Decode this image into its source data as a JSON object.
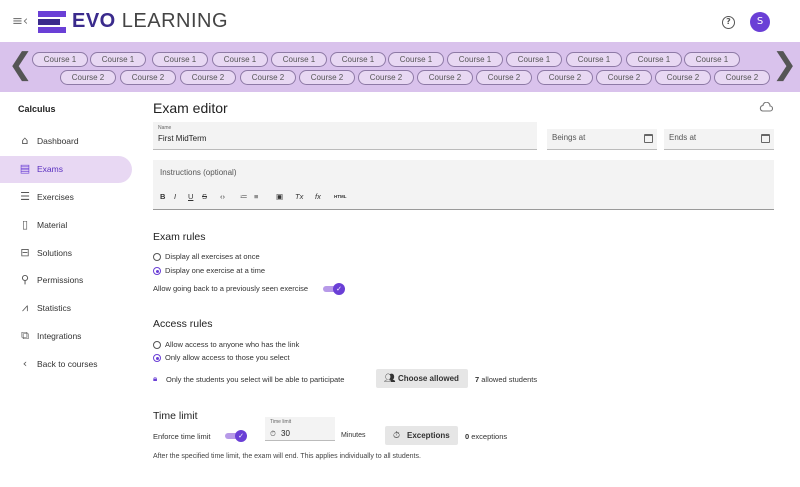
{
  "app": {
    "brand_bold": "EVO",
    "brand_rest": " LEARNING",
    "avatar_initial": "S",
    "help_symbol": "?",
    "menu_icon": "menu-collapse-icon",
    "accent_color": "#6a3fd6",
    "carousel_color": "#d9c2ec"
  },
  "carousel": {
    "row1": [
      "Course 1",
      "Course 1",
      "Course 1",
      "Course 1",
      "Course 1",
      "Course 1",
      "Course 1",
      "Course 1",
      "Course 1",
      "Course 1",
      "Course 1",
      "Course 1"
    ],
    "row2": [
      "Course 2",
      "Course 2",
      "Course 2",
      "Course 2",
      "Course 2",
      "Course 2",
      "Course 2",
      "Course 2",
      "Course 2",
      "Course 2",
      "Course 2",
      "Course 2"
    ],
    "prev_symbol": "❮",
    "next_symbol": "❯"
  },
  "sidebar": {
    "title": "Calculus",
    "items": [
      {
        "label": "Dashboard",
        "icon": "home-icon",
        "glyph": "⌂",
        "active": false
      },
      {
        "label": "Exams",
        "icon": "exam-icon",
        "glyph": "▤",
        "active": true
      },
      {
        "label": "Exercises",
        "icon": "exercises-icon",
        "glyph": "☰",
        "active": false
      },
      {
        "label": "Material",
        "icon": "material-icon",
        "glyph": "▯",
        "active": false
      },
      {
        "label": "Solutions",
        "icon": "solutions-icon",
        "glyph": "⊟",
        "active": false
      },
      {
        "label": "Permissions",
        "icon": "permissions-icon",
        "glyph": "⚲",
        "active": false
      },
      {
        "label": "Statistics",
        "icon": "statistics-icon",
        "glyph": "⩘",
        "active": false
      },
      {
        "label": "Integrations",
        "icon": "integrations-icon",
        "glyph": "⧉",
        "active": false
      },
      {
        "label": "Back to courses",
        "icon": "back-icon",
        "glyph": "‹",
        "active": false
      }
    ]
  },
  "main": {
    "title": "Exam editor",
    "name_field": {
      "label": "Name",
      "value": "First MidTerm"
    },
    "begins_field": {
      "placeholder": "Beings at"
    },
    "ends_field": {
      "placeholder": "Ends at"
    },
    "instructions_placeholder": "Instructions (optional)",
    "toolbar": [
      "B",
      "I",
      "U",
      "S",
      "‹›",
      "≔",
      "≡",
      "▣",
      "Tx",
      "fx",
      "HTML"
    ],
    "exam_rules": {
      "title": "Exam rules",
      "option1": "Display all exercises at once",
      "option2": "Display one exercise at a time",
      "selected": 2,
      "back_label": "Allow going back to a previously seen exercise",
      "back_enabled": true
    },
    "access_rules": {
      "title": "Access rules",
      "option1": "Allow access to anyone who has the link",
      "option2": "Only allow access to those you select",
      "selected": 2,
      "note": "Only the students you select will be able to participate",
      "choose_button": "Choose allowed",
      "allowed_count": "7",
      "allowed_suffix": " allowed students"
    },
    "time_limit": {
      "title": "Time limit",
      "enforce_label": "Enforce time limit",
      "enforce_enabled": true,
      "field_label": "Time limit",
      "value": "30",
      "unit": "Minutes",
      "exceptions_button": "Exceptions",
      "exceptions_count": "0",
      "exceptions_suffix": " exceptions",
      "footer": "After the specified time limit, the exam will end. This applies individually to all students."
    }
  }
}
